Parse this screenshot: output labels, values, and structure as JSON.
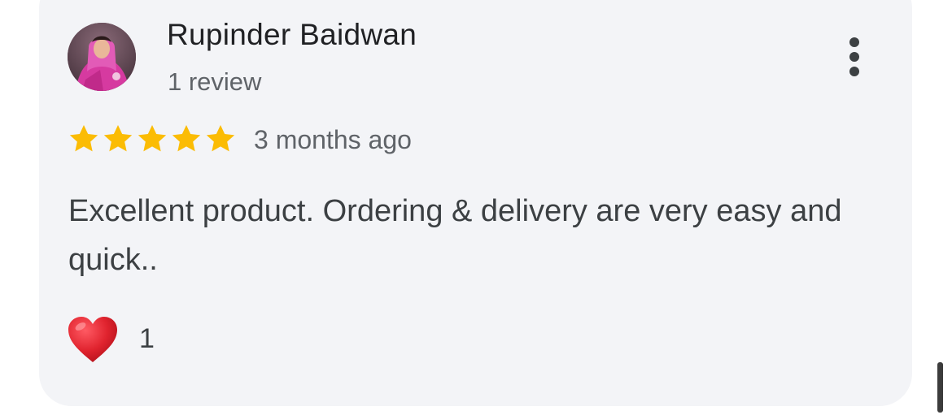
{
  "reviewer": {
    "name": "Rupinder Baidwan",
    "review_count": "1 review",
    "avatar": "reviewer-photo"
  },
  "rating": {
    "stars": 5,
    "max": 5,
    "star_color": "#fbbc04",
    "time_ago": "3 months ago"
  },
  "review": {
    "text": "Excellent product. Ordering & delivery are very easy and quick.."
  },
  "reactions": {
    "icon": "red-heart-icon",
    "count": "1"
  },
  "menu": {
    "icon": "more-vertical-icon"
  },
  "colors": {
    "card_background": "#f3f4f7",
    "heart": "#e0232e"
  }
}
